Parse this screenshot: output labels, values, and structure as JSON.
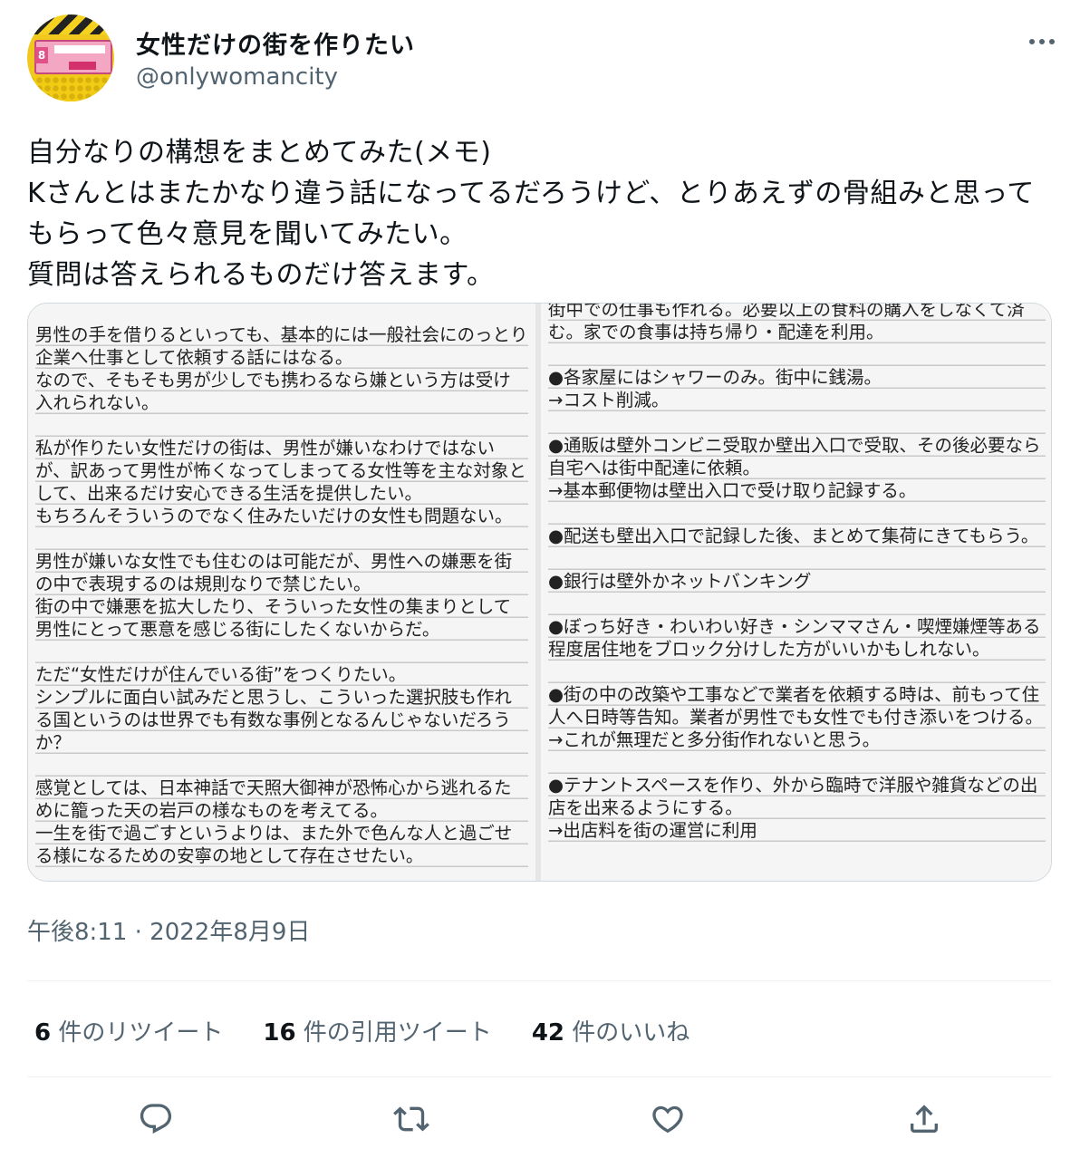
{
  "account": {
    "display_name": "女性だけの街を作りたい",
    "handle": "@onlywomancity",
    "avatar_sign_number": "8"
  },
  "tweet": {
    "text": "自分なりの構想をまとめてみた(メモ)\nKさんとはまたかなり違う話になってるだろうけど、とりあえずの骨組みと思ってもらって色々意見を聞いてみたい。\n質問は答えられるものだけ答えます。",
    "timestamp": "午後8:11 · 2022年8月9日"
  },
  "image_text": {
    "left_column": "男性の手を借りるといっても、基本的には一般社会にのっとり企業へ仕事として依頼する話にはなる。\nなので、そもそも男が少しでも携わるなら嫌という方は受け入れられない。\n\n私が作りたい女性だけの街は、男性が嫌いなわけではないが、訳あって男性が怖くなってしまってる女性等を主な対象として、出来るだけ安心できる生活を提供したい。\nもちろんそういうのでなく住みたいだけの女性も問題ない。\n\n男性が嫌いな女性でも住むのは可能だが、男性への嫌悪を街の中で表現するのは規則なりで禁じたい。\n街の中で嫌悪を拡大したり、そういった女性の集まりとして男性にとって悪意を感じる街にしたくないからだ。\n\nただ“女性だけが住んでいる街”をつくりたい。\nシンプルに面白い試みだと思うし、こういった選択肢も作れる国というのは世界でも有数な事例となるんじゃないだろうか？\n\n感覚としては、日本神話で天照大御神が恐怖心から逃れるために籠った天の岩戸の様なものを考えてる。\n一生を街で過ごすというよりは、また外で色んな人と過ごせる様になるための安寧の地として存在させたい。",
    "right_column": "街中での仕事も作れる。必要以上の食料の購入をしなくて済む。家での食事は持ち帰り・配達を利用。\n\n●各家屋にはシャワーのみ。街中に銭湯。\n→コスト削減。\n\n●通販は壁外コンビニ受取か壁出入口で受取、その後必要なら自宅へは街中配達に依頼。\n→基本郵便物は壁出入口で受け取り記録する。\n\n●配送も壁出入口で記録した後、まとめて集荷にきてもらう。\n\n●銀行は壁外かネットバンキング\n\n●ぼっち好き・わいわい好き・シンママさん・喫煙嫌煙等ある程度居住地をブロック分けした方がいいかもしれない。\n\n●街の中の改築や工事などで業者を依頼する時は、前もって住人へ日時等告知。業者が男性でも女性でも付き添いをつける。\n→これが無理だと多分街作れないと思う。\n\n●テナントスペースを作り、外から臨時で洋服や雑貨などの出店を出来るようにする。\n→出店料を街の運営に利用"
  },
  "stats": {
    "retweets_count": "6",
    "retweets_label": " 件のリツイート",
    "quotes_count": "16",
    "quotes_label": " 件の引用ツイート",
    "likes_count": "42",
    "likes_label": " 件のいいね"
  },
  "icons": {
    "reply": "reply-icon",
    "retweet": "retweet-icon",
    "like": "heart-icon",
    "share": "share-icon",
    "more": "more-icon"
  },
  "colors": {
    "text_primary": "#0f1419",
    "text_secondary": "#536471",
    "divider": "#eff3f4",
    "media_border": "#cfd9de"
  }
}
